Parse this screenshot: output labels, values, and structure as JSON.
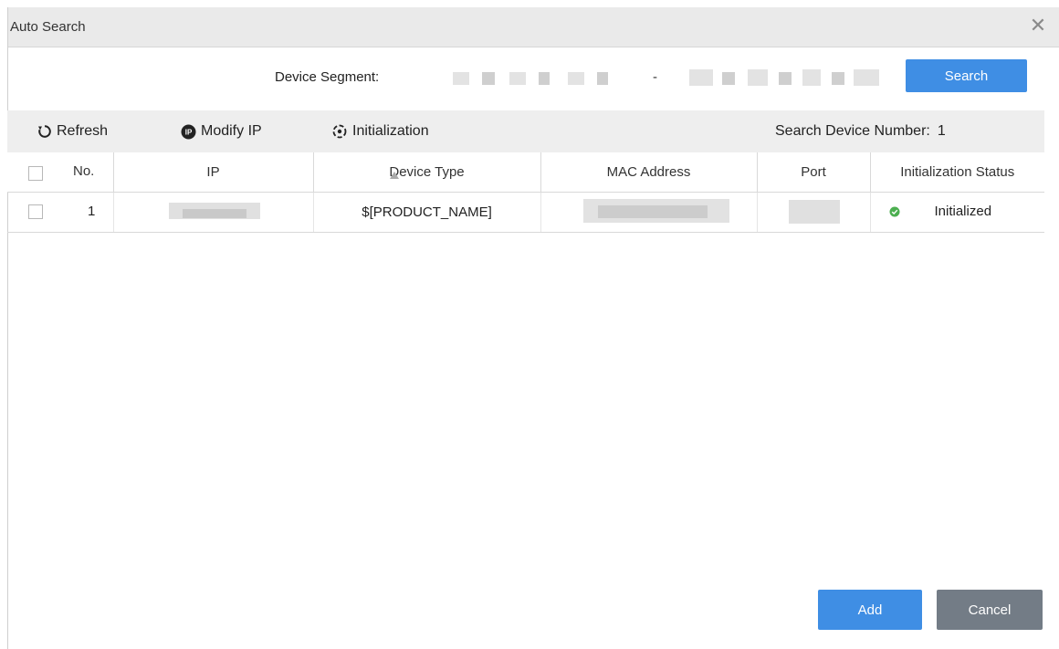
{
  "dialog": {
    "title": "Auto Search",
    "close_icon": "close-icon"
  },
  "segment": {
    "label": "Device Segment:",
    "separator": "-",
    "search_label": "Search"
  },
  "toolbar": {
    "refresh_label": "Refresh",
    "modify_ip_label": "Modify IP",
    "initialization_label": "Initialization",
    "count_label": "Search Device Number:",
    "count_value": "1"
  },
  "table": {
    "columns": [
      "No.",
      "IP",
      "Device Type",
      "MAC Address",
      "Port",
      "Initialization Status"
    ],
    "rows": [
      {
        "no": "1",
        "device_type": "$[PRODUCT_NAME]",
        "status": "Initialized"
      }
    ]
  },
  "footer": {
    "add_label": "Add",
    "cancel_label": "Cancel"
  },
  "colors": {
    "primary": "#3f8ee4",
    "cancel": "#737c86",
    "status_ok": "#4caf50"
  }
}
